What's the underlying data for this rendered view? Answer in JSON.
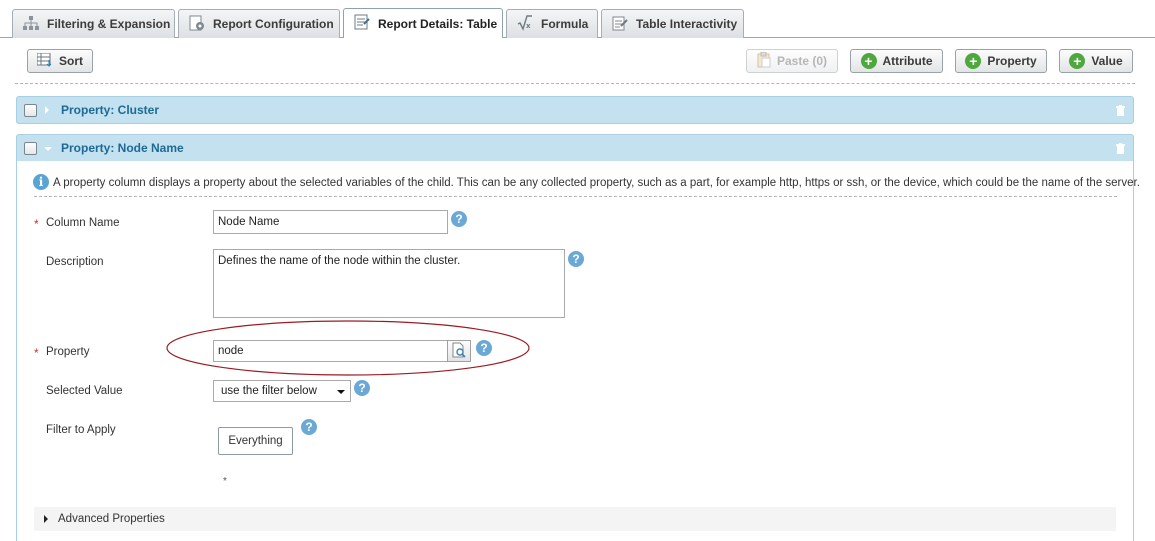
{
  "tabs": [
    {
      "label": "Filtering & Expansion",
      "icon": "hierarchy-icon",
      "active": false
    },
    {
      "label": "Report Configuration",
      "icon": "report-config-icon",
      "active": false
    },
    {
      "label": "Report Details: Table",
      "icon": "report-table-icon",
      "active": true
    },
    {
      "label": "Formula",
      "icon": "formula-icon",
      "active": false
    },
    {
      "label": "Table Interactivity",
      "icon": "table-edit-icon",
      "active": false
    }
  ],
  "toolbar": {
    "sort_label": "Sort",
    "paste_label": "Paste (0)",
    "attribute_label": "Attribute",
    "property_label": "Property",
    "value_label": "Value",
    "plus_glyph": "+"
  },
  "panels": {
    "cluster_title": "Property: Cluster",
    "node_title": "Property: Node Name"
  },
  "info": {
    "glyph": "i",
    "text": "A property column displays a property about the selected variables of the child. This can be any collected property, such as a part, for example http, https or ssh, or the device, which could be the name of the server."
  },
  "form": {
    "required_mark": "*",
    "help_glyph": "?",
    "column_name_label": "Column Name",
    "column_name_value": "Node Name",
    "description_label": "Description",
    "description_value": "Defines the name of the node within the cluster.",
    "property_label": "Property",
    "property_value": "node",
    "selected_value_label": "Selected Value",
    "selected_value": "use the filter below",
    "filter_label": "Filter to Apply",
    "filter_button": "Everything",
    "filter_star": "*",
    "advanced_label": "Advanced Properties"
  },
  "colors": {
    "panel_header": "#c3e1ef",
    "panel_title": "#1d6a96",
    "highlight_ellipse": "#9b1c24",
    "add_green": "#4fa83d",
    "help_blue": "#6aa9d6"
  }
}
